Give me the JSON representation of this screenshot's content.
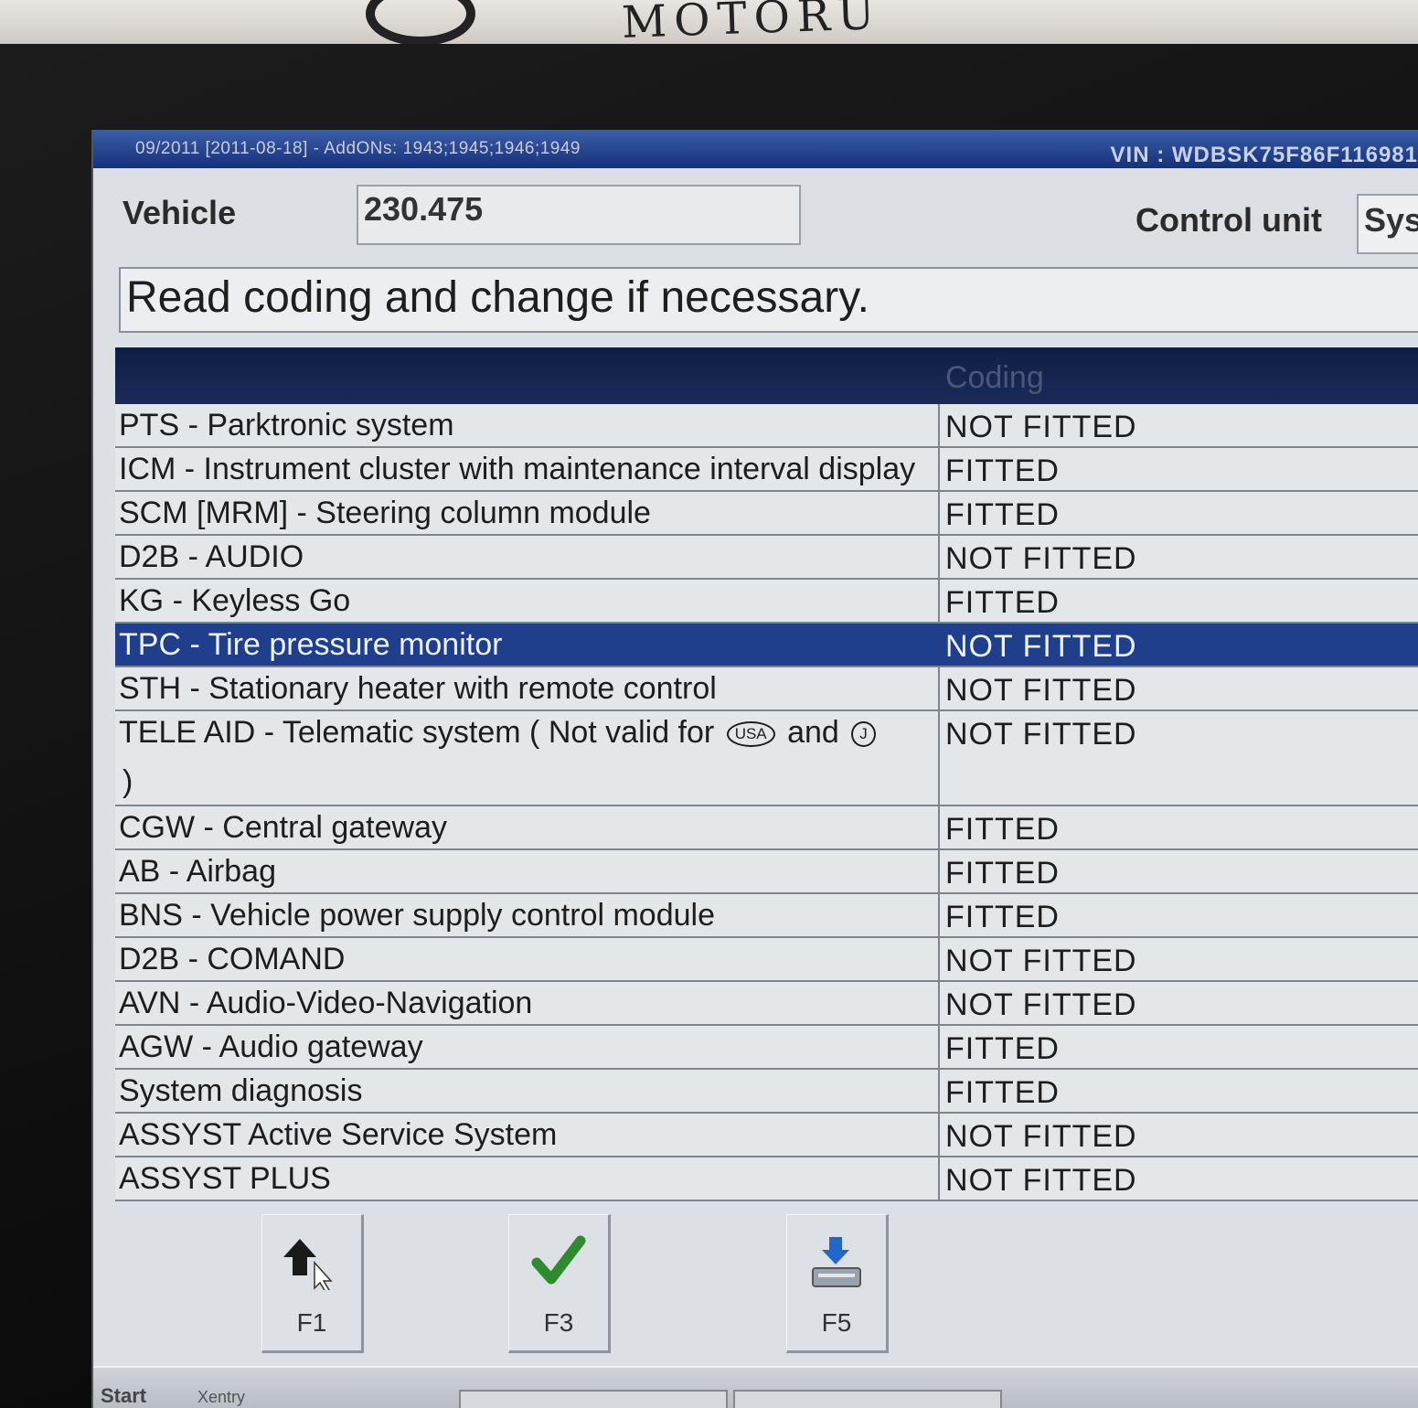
{
  "photo": {
    "logo_text": "MOTORU"
  },
  "titlebar": {
    "addons": "09/2011 [2011-08-18] - AddONs: 1943;1945;1946;1949",
    "vin": "VIN : WDBSK75F86F116981"
  },
  "header": {
    "vehicle_label": "Vehicle",
    "vehicle_value": "230.475",
    "control_unit_label": "Control unit",
    "control_unit_value": "Sys"
  },
  "instruction": "Read coding and change if necessary.",
  "table": {
    "header_coding": "Coding",
    "rows": [
      {
        "name": "PTS - Parktronic system",
        "value": "NOT FITTED"
      },
      {
        "name": "ICM - Instrument cluster with maintenance interval display",
        "value": "FITTED"
      },
      {
        "name": "SCM [MRM] - Steering column module",
        "value": "FITTED"
      },
      {
        "name": "D2B - AUDIO",
        "value": "NOT FITTED"
      },
      {
        "name": "KG - Keyless Go",
        "value": "FITTED"
      },
      {
        "name": "TPC - Tire pressure monitor",
        "value": "NOT FITTED",
        "selected": true
      },
      {
        "name": "STH - Stationary heater with remote control",
        "value": "NOT FITTED"
      },
      {
        "name": "TELE AID - Telematic system ( Not valid for",
        "name_and": "and",
        "name_close": ")",
        "badge1": "USA",
        "badge2": "J",
        "value": "NOT FITTED"
      },
      {
        "name": "CGW - Central gateway",
        "value": "FITTED"
      },
      {
        "name": "AB - Airbag",
        "value": "FITTED"
      },
      {
        "name": "BNS - Vehicle power supply control module",
        "value": "FITTED"
      },
      {
        "name": "D2B - COMAND",
        "value": "NOT FITTED"
      },
      {
        "name": "AVN - Audio-Video-Navigation",
        "value": "NOT FITTED"
      },
      {
        "name": "AGW - Audio gateway",
        "value": "FITTED"
      },
      {
        "name": "System diagnosis",
        "value": "FITTED"
      },
      {
        "name": "ASSYST Active Service System",
        "value": "NOT FITTED"
      },
      {
        "name": "ASSYST PLUS",
        "value": "NOT FITTED"
      }
    ]
  },
  "fkeys": {
    "f1": {
      "label": "F1",
      "icon": "arrow-up-icon"
    },
    "f3": {
      "label": "F3",
      "icon": "checkmark-icon"
    },
    "f5": {
      "label": "F5",
      "icon": "print-icon"
    }
  },
  "taskbar": {
    "start": "Start",
    "xentry": "Xentry"
  },
  "colors": {
    "titlebar": "#16307a",
    "selected_row": "#1f3f8c",
    "checkmark": "#2e8b2e",
    "print_arrow": "#2266cc"
  }
}
